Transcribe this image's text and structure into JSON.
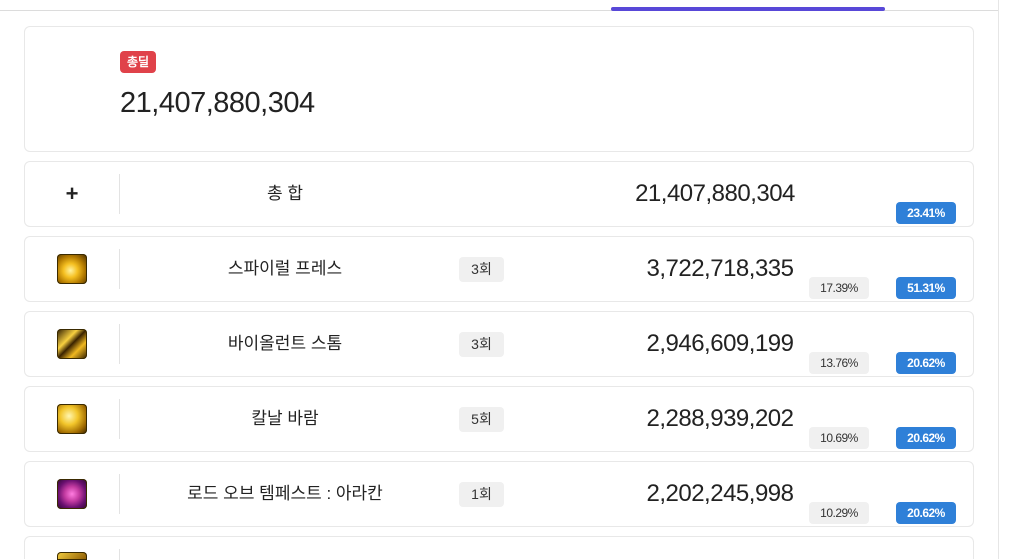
{
  "summary": {
    "badge": "총딜",
    "total": "21,407,880,304"
  },
  "total_row": {
    "name": "총 합",
    "value": "21,407,880,304",
    "pct_blue": "23.41%"
  },
  "skills": [
    {
      "icon": "spiral-press-skill-icon",
      "name": "스파이럴 프레스",
      "count": "3회",
      "value": "3,722,718,335",
      "pct_grey": "17.39%",
      "pct_blue": "51.31%"
    },
    {
      "icon": "violent-storm-skill-icon",
      "name": "바이올런트 스톰",
      "count": "3회",
      "value": "2,946,609,199",
      "pct_grey": "13.76%",
      "pct_blue": "20.62%"
    },
    {
      "icon": "blade-wind-skill-icon",
      "name": "칼날 바람",
      "count": "5회",
      "value": "2,288,939,202",
      "pct_grey": "10.69%",
      "pct_blue": "20.62%"
    },
    {
      "icon": "lord-of-tempest-skill-icon",
      "name": "로드 오브 템페스트 : 아라칸",
      "count": "1회",
      "value": "2,202,245,998",
      "pct_grey": "10.29%",
      "pct_blue": "20.62%"
    }
  ],
  "colors": {
    "badge": "#e0424a",
    "pct_blue": "#2f80d8",
    "tab_indicator": "#5848d8"
  }
}
